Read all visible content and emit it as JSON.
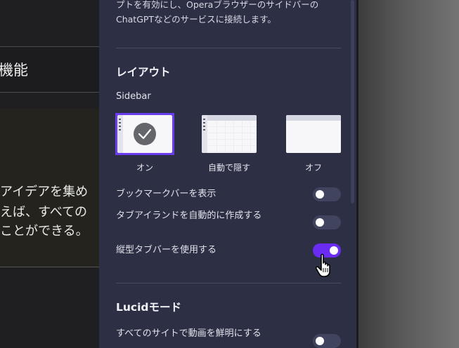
{
  "background_app": {
    "heading": "機能",
    "lines": [
      "アイデアを集め",
      "えば、すべての",
      "ことができる。"
    ]
  },
  "panel": {
    "intro_lines": [
      "プトを有効にし、Operaブラウザーのサイドバーの",
      "ChatGPTなどのサービスに接続します。"
    ],
    "layout_section": {
      "title": "レイアウト",
      "sidebar_label": "Sidebar",
      "options": [
        {
          "label": "オン",
          "selected": true
        },
        {
          "label": "自動で隠す",
          "selected": false
        },
        {
          "label": "オフ",
          "selected": false
        }
      ]
    },
    "toggles": [
      {
        "label": "ブックマークバーを表示",
        "on": false
      },
      {
        "label": "タブアイランドを自動的に作成する",
        "on": false
      },
      {
        "label": "縦型タブバーを使用する",
        "on": true
      }
    ],
    "lucid_section": {
      "title": "Lucidモード",
      "toggles": [
        {
          "label": "すべてのサイトで動画を鮮明にする",
          "on": false
        }
      ]
    }
  },
  "colors": {
    "panel_bg": "#2d2f44",
    "accent": "#6a2cf2",
    "toggle_off": "#41445e"
  },
  "icons": [
    "checkmark-icon",
    "hand-pointer-cursor"
  ]
}
